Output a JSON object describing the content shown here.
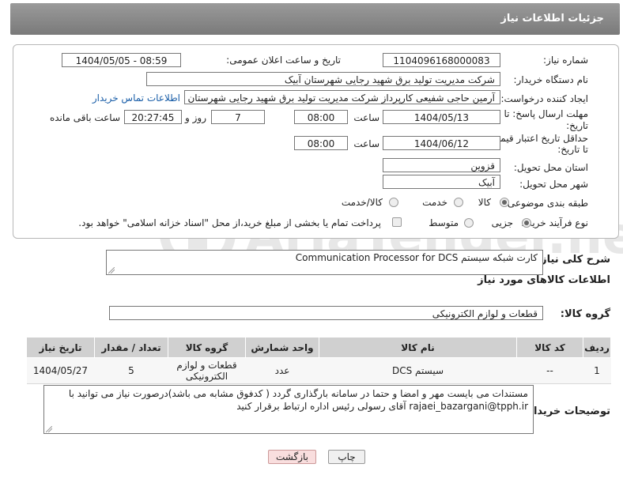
{
  "header": {
    "title": "جزئیات اطلاعات نیاز"
  },
  "form": {
    "need_number": {
      "label": "شماره نیاز:",
      "value": "1104096168000083"
    },
    "announce_datetime": {
      "label": "تاریخ و ساعت اعلان عمومی:",
      "value": "1404/05/05 - 08:59"
    },
    "buyer_org": {
      "label": "نام دستگاه خریدار:",
      "value": "شرکت مدیریت تولید برق شهید رجایی شهرستان آبیک"
    },
    "requester": {
      "label": "ایجاد کننده درخواست:",
      "value": "آرمین حاجی شفیعی کارپرداز شرکت مدیریت تولید برق شهید رجایی شهرستان",
      "contact_link": "اطلاعات تماس خریدار"
    },
    "reply_deadline": {
      "label_line1": "مهلت ارسال پاسخ: تا",
      "label_line2": "تاریخ:",
      "date": "1404/05/13",
      "time_label": "ساعت",
      "time": "08:00",
      "days": "7",
      "days_label": "روز و",
      "remaining": "20:27:45",
      "remaining_label": "ساعت باقی مانده"
    },
    "price_validity": {
      "label_line1": "حداقل تاریخ اعتبار قیمت:",
      "label_line2": "تا تاریخ:",
      "date": "1404/06/12",
      "time_label": "ساعت",
      "time": "08:00"
    },
    "province": {
      "label": "استان محل تحویل:",
      "value": "قزوین"
    },
    "city": {
      "label": "شهر محل تحویل:",
      "value": "آبیک"
    },
    "category": {
      "label": "طبقه بندی موضوعی:",
      "options": [
        "کالا",
        "خدمت",
        "کالا/خدمت"
      ],
      "selected": "کالا"
    },
    "process_type": {
      "label": "نوع فرآیند خرید :",
      "options": [
        "جزیی",
        "متوسط"
      ],
      "selected": "جزیی",
      "payment_note": "پرداخت تمام یا بخشی از مبلغ خرید،از محل \"اسناد خزانه اسلامی\" خواهد بود."
    }
  },
  "summary": {
    "label": "شرح کلی نیاز:",
    "value": "کارت شبکه سیستم Communication Processor for   DCS"
  },
  "goods_info": {
    "title": "اطلاعات کالاهای مورد نیاز",
    "group_label": "گروه کالا:",
    "group_value": "قطعات و لوازم الکترونیکی"
  },
  "table": {
    "headers": [
      "ردیف",
      "کد کالا",
      "نام کالا",
      "واحد شمارش",
      "گروه کالا",
      "تعداد / مقدار",
      "تاریخ نیاز"
    ],
    "rows": [
      [
        "1",
        "--",
        "سیستم DCS",
        "عدد",
        "قطعات و لوازم الکترونیکی",
        "5",
        "1404/05/27"
      ]
    ]
  },
  "buyer_notes": {
    "label": "توضیحات خریدار:",
    "value": "مستندات می بایست مهر و امضا و حتما در سامانه بارگذاری گردد ( کدفوق مشابه می باشد)درصورت نیاز می توانید با rajaei_bazargani@tpph.ir آقای رسولی رئیس  اداره ارتباط برقرار کنید"
  },
  "buttons": {
    "print": "چاپ",
    "back": "بازگشت"
  },
  "watermark": "AriaTender.net",
  "colors": {
    "header_bg": "#8a8a8a",
    "link": "#1a5ea8",
    "back_button_bg": "#f9dede"
  }
}
